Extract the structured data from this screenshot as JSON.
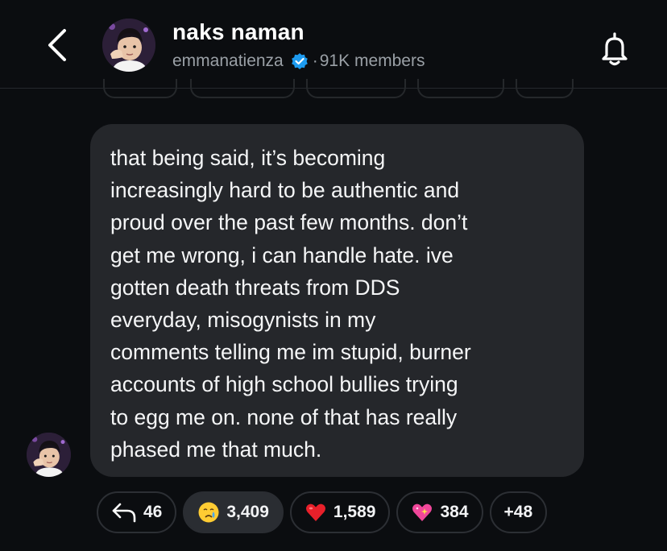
{
  "header": {
    "title": "naks naman",
    "author": "emmanatienza",
    "separator": "·",
    "members": "91K members",
    "icons": {
      "back": "chevron-left-icon",
      "verified": "verified-badge-icon",
      "notify": "bell-icon"
    },
    "accent": "#1d9bf0"
  },
  "message": {
    "text": "that being said, it’s becoming\nincreasingly hard to be authentic and\nproud over the past few months. don’t\nget me wrong, i can handle hate. ive\ngotten death threats from DDS\neveryday, misogynists in my\ncomments telling me im stupid, burner\naccounts of high school bullies trying\nto egg me on. none of that has really\nphased me that much.",
    "bubble_color": "#25272b"
  },
  "reactions": {
    "reply": {
      "icon": "reply-arrow-icon",
      "count": "46"
    },
    "items": [
      {
        "icon": "crying-face-emoji",
        "count": "3,409",
        "active": true
      },
      {
        "icon": "red-heart-emoji",
        "count": "1,589",
        "active": false
      },
      {
        "icon": "sparkling-heart-emoji",
        "count": "384",
        "active": false
      }
    ],
    "more": "+48"
  }
}
